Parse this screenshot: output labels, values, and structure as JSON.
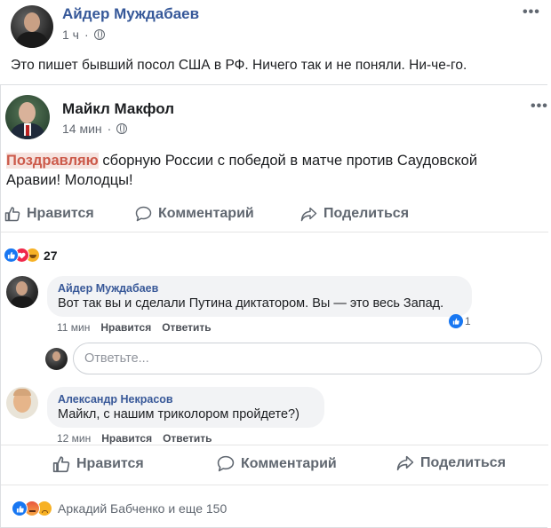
{
  "outer_post": {
    "author": "Айдер Муждабаев",
    "time": "1 ч",
    "text": "Это пишет бывший посол США в РФ. Ничего так и не поняли. Ни-че-го.",
    "more": "•••"
  },
  "shared_post": {
    "author": "Майкл Макфол",
    "time": "14 мин",
    "text_highlight": "Поздравляю",
    "text_line1": " сборную России с победой в матче против Саудовской",
    "text_line2": "Аравии! Молодцы!",
    "more": "•••",
    "actions": {
      "like": "Нравится",
      "comment": "Комментарий",
      "share": "Поделиться"
    },
    "reaction_count": "27",
    "reaction_icons": [
      "like-icon",
      "love-icon",
      "haha-icon"
    ]
  },
  "comments": [
    {
      "author": "Айдер Муждабаев",
      "text": "Вот так вы и сделали Путина диктатором. Вы — это весь Запад.",
      "time": "11 мин",
      "like": "Нравится",
      "reply": "Ответить",
      "reactions": "1"
    },
    {
      "author": "Александр Некрасов",
      "text": "Майкл, с нашим триколором пройдете?)",
      "time": "12 мин",
      "like": "Нравится",
      "reply": "Ответить"
    }
  ],
  "reply_input": {
    "placeholder": "Ответьте..."
  },
  "outer_actions": {
    "like": "Нравится",
    "comment": "Комментарий",
    "share": "Поделиться"
  },
  "outer_reactions": {
    "text": "Аркадий Бабченко и еще 150",
    "icons": [
      "like-icon",
      "angry-icon",
      "sad-icon"
    ]
  },
  "colors": {
    "link_blue": "#365899",
    "like_blue": "#1877f2",
    "love_red": "#f0284a",
    "haha_yellow": "#f7b125",
    "highlight_red": "#cc5a4a",
    "border": "#dddfe2"
  }
}
